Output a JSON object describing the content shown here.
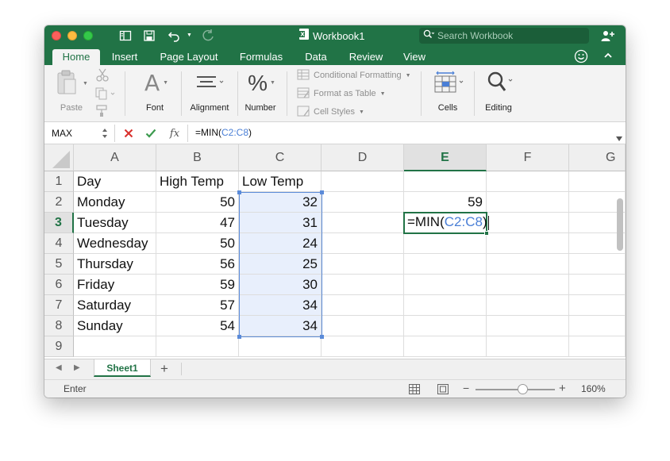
{
  "window": {
    "title": "Workbook1"
  },
  "search": {
    "placeholder": "Search Workbook"
  },
  "tabs": [
    {
      "label": "Home",
      "active": true
    },
    {
      "label": "Insert"
    },
    {
      "label": "Page Layout"
    },
    {
      "label": "Formulas"
    },
    {
      "label": "Data"
    },
    {
      "label": "Review"
    },
    {
      "label": "View"
    }
  ],
  "ribbon": {
    "paste": "Paste",
    "font": "Font",
    "alignment": "Alignment",
    "number": "Number",
    "number_symbol": "%",
    "font_symbol": "A",
    "conditional_formatting": "Conditional Formatting",
    "format_as_table": "Format as Table",
    "cell_styles": "Cell Styles",
    "cells": "Cells",
    "editing": "Editing"
  },
  "formula_bar": {
    "name_box": "MAX",
    "fx": "fx",
    "formula_prefix": "=MIN(",
    "formula_ref": "C2:C8",
    "formula_suffix": ")"
  },
  "grid": {
    "columns": [
      "A",
      "B",
      "C",
      "D",
      "E",
      "F",
      "G"
    ],
    "rows": [
      "1",
      "2",
      "3",
      "4",
      "5",
      "6",
      "7",
      "8",
      "9"
    ],
    "header_row": [
      "Day",
      "High Temp",
      "Low Temp"
    ],
    "data": [
      {
        "day": "Monday",
        "high": "50",
        "low": "32"
      },
      {
        "day": "Tuesday",
        "high": "47",
        "low": "31"
      },
      {
        "day": "Wednesday",
        "high": "50",
        "low": "24"
      },
      {
        "day": "Thursday",
        "high": "56",
        "low": "25"
      },
      {
        "day": "Friday",
        "high": "59",
        "low": "30"
      },
      {
        "day": "Saturday",
        "high": "57",
        "low": "34"
      },
      {
        "day": "Sunday",
        "high": "54",
        "low": "34"
      }
    ],
    "e2_value": "59",
    "active_cell_prefix": "=MIN(",
    "active_cell_ref": "C2:C8",
    "active_cell_suffix": ")"
  },
  "sheets": [
    {
      "label": "Sheet1",
      "active": true
    }
  ],
  "add_sheet": "+",
  "status": {
    "mode": "Enter",
    "zoom": "160%",
    "zoom_minus": "−",
    "zoom_plus": "+"
  },
  "colors": {
    "brand": "#217346",
    "range_ref": "#5b8bd9",
    "range_fill": "#e8effc"
  }
}
